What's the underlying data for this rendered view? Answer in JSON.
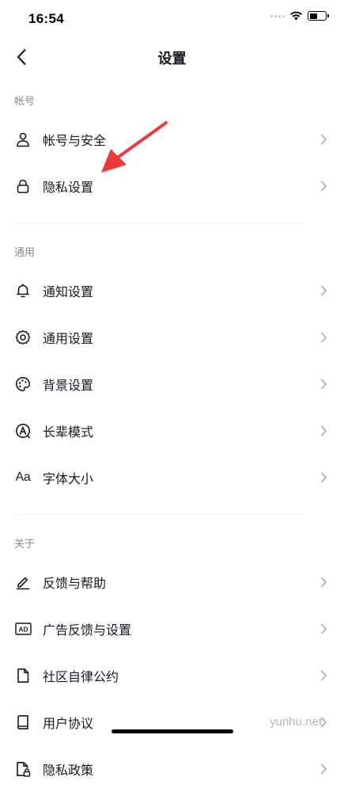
{
  "status_bar": {
    "time": "16:54"
  },
  "nav": {
    "title": "设置"
  },
  "sections": [
    {
      "title": "帐号",
      "items": [
        {
          "label": "帐号与安全",
          "icon": "user-icon"
        },
        {
          "label": "隐私设置",
          "icon": "lock-icon"
        }
      ]
    },
    {
      "title": "通用",
      "items": [
        {
          "label": "通知设置",
          "icon": "bell-icon"
        },
        {
          "label": "通用设置",
          "icon": "gear-icon"
        },
        {
          "label": "背景设置",
          "icon": "palette-icon"
        },
        {
          "label": "长辈模式",
          "icon": "elder-mode-icon"
        },
        {
          "label": "字体大小",
          "icon": "font-size-icon",
          "icon_text": "Aa"
        }
      ]
    },
    {
      "title": "关于",
      "items": [
        {
          "label": "反馈与帮助",
          "icon": "edit-icon"
        },
        {
          "label": "广告反馈与设置",
          "icon": "ad-icon",
          "icon_text": "AD"
        },
        {
          "label": "社区自律公约",
          "icon": "document-icon"
        },
        {
          "label": "用户协议",
          "icon": "book-icon"
        },
        {
          "label": "隐私政策",
          "icon": "privacy-doc-icon"
        }
      ]
    }
  ],
  "watermark": "yunhu.net",
  "colors": {
    "text_primary": "#161823",
    "text_secondary": "#8a8b91",
    "chevron": "#b0b1b5",
    "divider": "#ececec",
    "annotation_arrow": "#ee3a3a"
  }
}
